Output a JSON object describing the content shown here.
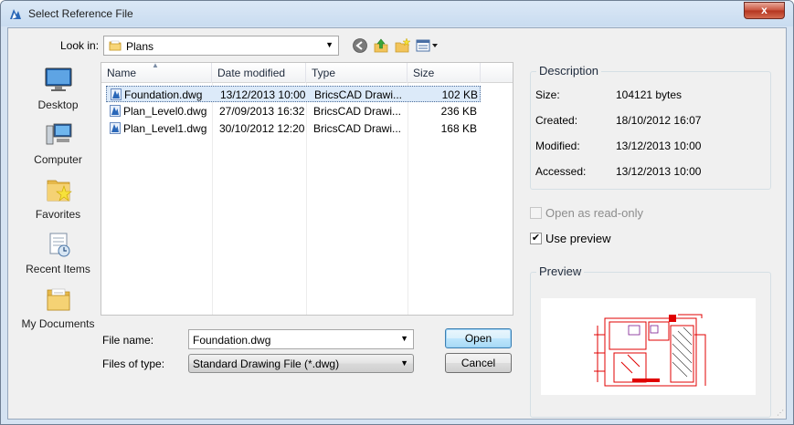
{
  "window": {
    "title": "Select Reference File",
    "close_label": "x"
  },
  "lookin": {
    "label": "Look in:",
    "value": "Plans"
  },
  "places": [
    {
      "label": "Desktop",
      "icon": "desktop-icon"
    },
    {
      "label": "Computer",
      "icon": "computer-icon"
    },
    {
      "label": "Favorites",
      "icon": "favorites-icon"
    },
    {
      "label": "Recent Items",
      "icon": "recent-items-icon"
    },
    {
      "label": "My Documents",
      "icon": "my-documents-icon"
    }
  ],
  "file_list": {
    "columns": [
      "Name",
      "Date modified",
      "Type",
      "Size"
    ],
    "rows": [
      {
        "name": "Foundation.dwg",
        "date": "13/12/2013 10:00",
        "type": "BricsCAD Drawi...",
        "size": "102 KB",
        "selected": true
      },
      {
        "name": "Plan_Level0.dwg",
        "date": "27/09/2013 16:32",
        "type": "BricsCAD Drawi...",
        "size": "236 KB",
        "selected": false
      },
      {
        "name": "Plan_Level1.dwg",
        "date": "30/10/2012 12:20",
        "type": "BricsCAD Drawi...",
        "size": "168 KB",
        "selected": false
      }
    ]
  },
  "file_name": {
    "label": "File name:",
    "value": "Foundation.dwg"
  },
  "file_type": {
    "label": "Files of type:",
    "value": "Standard Drawing File (*.dwg)"
  },
  "buttons": {
    "open": "Open",
    "cancel": "Cancel"
  },
  "description": {
    "title": "Description",
    "size_label": "Size:",
    "size_value": "104121 bytes",
    "created_label": "Created:",
    "created_value": "18/10/2012 16:07",
    "modified_label": "Modified:",
    "modified_value": "13/12/2013 10:00",
    "accessed_label": "Accessed:",
    "accessed_value": "13/12/2013 10:00"
  },
  "options": {
    "read_only_label": "Open as read-only",
    "read_only_checked": false,
    "use_preview_label": "Use preview",
    "use_preview_checked": true
  },
  "preview": {
    "title": "Preview"
  },
  "colors": {
    "accent": "#3c7fb1",
    "selection": "#dceaf9",
    "preview_red": "#e00000"
  }
}
